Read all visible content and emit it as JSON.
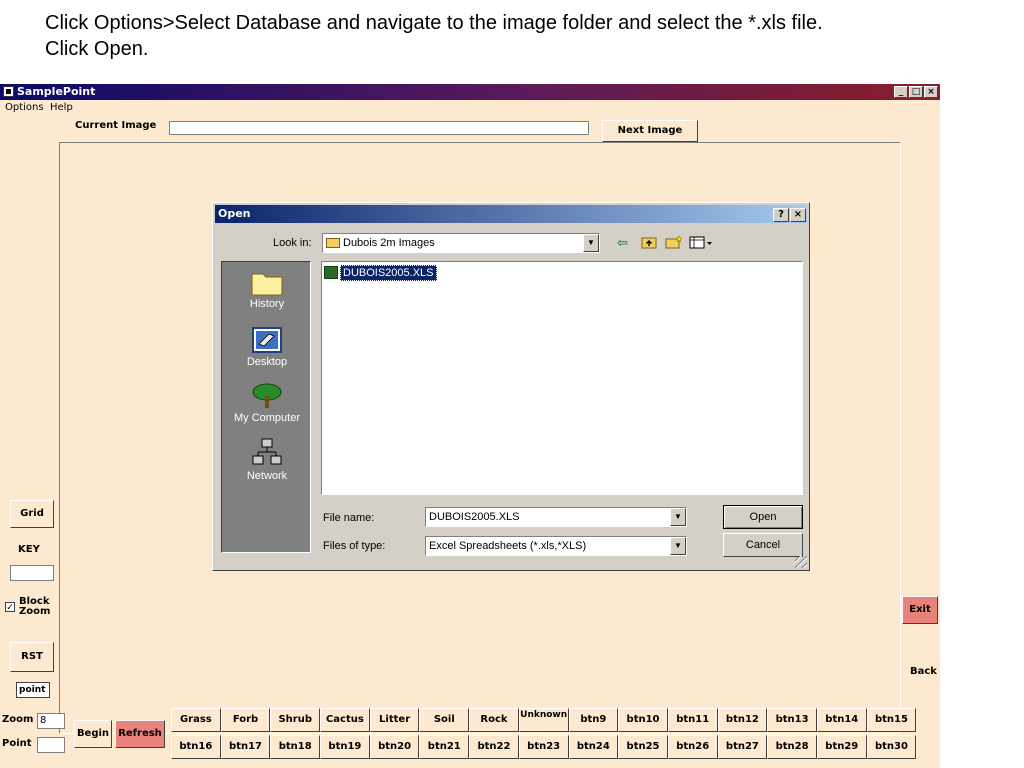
{
  "caption": {
    "line1": "Click Options>Select Database and navigate to the image folder and select the *.xls file.",
    "line2": "Click Open."
  },
  "window": {
    "title": "SamplePoint",
    "controls": {
      "minimize": "_",
      "maximize": "□",
      "close": "×"
    }
  },
  "menu": {
    "options": "Options",
    "help": "Help"
  },
  "top": {
    "current_image_label": "Current Image",
    "current_image_value": "",
    "next_image_label": "Next Image"
  },
  "left": {
    "grid_label": "Grid",
    "key_label": "KEY",
    "block_zoom_label": "Block Zoom",
    "block_zoom_checked": true,
    "rst_label": "RST",
    "point_box": "point",
    "zoom_label": "Zoom",
    "zoom_value": "8",
    "point_label": "Point",
    "begin_label": "Begin",
    "refresh_label": "Refresh"
  },
  "right": {
    "exit_label": "Exit",
    "back_label": "Back"
  },
  "categories_row1": [
    "Grass",
    "Forb",
    "Shrub",
    "Cactus",
    "Litter",
    "Soil",
    "Rock",
    "Unknown",
    "btn9",
    "btn10",
    "btn11",
    "btn12",
    "btn13",
    "btn14",
    "btn15"
  ],
  "categories_row2": [
    "btn16",
    "btn17",
    "btn18",
    "btn19",
    "btn20",
    "btn21",
    "btn22",
    "btn23",
    "btn24",
    "btn25",
    "btn26",
    "btn27",
    "btn28",
    "btn29",
    "btn30"
  ],
  "dialog": {
    "title": "Open",
    "help_btn": "?",
    "close_btn": "×",
    "look_in_label": "Look in:",
    "look_in_value": "Dubois 2m Images",
    "places": [
      "History",
      "Desktop",
      "My Computer",
      "Network"
    ],
    "files": [
      {
        "name": "DUBOIS2005.XLS",
        "selected": true
      }
    ],
    "file_name_label": "File name:",
    "file_name_value": "DUBOIS2005.XLS",
    "file_type_label": "Files of type:",
    "file_type_value": "Excel Spreadsheets (*.xls,*XLS)",
    "open_label": "Open",
    "cancel_label": "Cancel"
  },
  "colors": {
    "app_bg": "#fde9d0",
    "dialog_bg": "#d4d0c8",
    "accent_red": "#e8827a",
    "selection": "#0a246a"
  }
}
